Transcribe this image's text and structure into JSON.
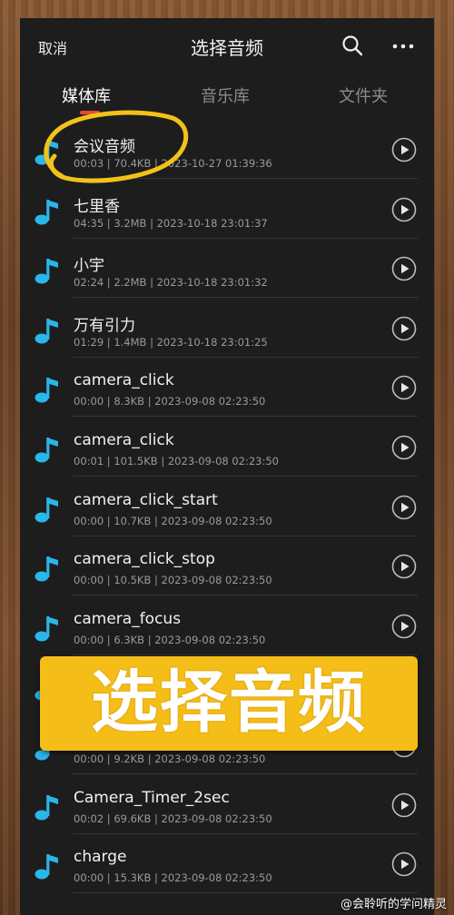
{
  "header": {
    "cancel_label": "取消",
    "title": "选择音频",
    "icons": [
      "search-icon",
      "more-icon"
    ]
  },
  "tabs": [
    {
      "label": "媒体库",
      "active": true
    },
    {
      "label": "音乐库",
      "active": false
    },
    {
      "label": "文件夹",
      "active": false
    }
  ],
  "files": [
    {
      "name": "会议音频",
      "meta": "00:03 | 70.4KB | 2023-10-27 01:39:36"
    },
    {
      "name": "七里香",
      "meta": "04:35 | 3.2MB | 2023-10-18 23:01:37"
    },
    {
      "name": "小宇",
      "meta": "02:24 | 2.2MB | 2023-10-18 23:01:32"
    },
    {
      "name": "万有引力",
      "meta": "01:29 | 1.4MB | 2023-10-18 23:01:25"
    },
    {
      "name": "camera_click",
      "meta": "00:00 | 8.3KB | 2023-09-08 02:23:50"
    },
    {
      "name": "camera_click",
      "meta": "00:01 | 101.5KB | 2023-09-08 02:23:50"
    },
    {
      "name": "camera_click_start",
      "meta": "00:00 | 10.7KB | 2023-09-08 02:23:50"
    },
    {
      "name": "camera_click_stop",
      "meta": "00:00 | 10.5KB | 2023-09-08 02:23:50"
    },
    {
      "name": "camera_focus",
      "meta": "00:00 | 6.3KB | 2023-09-08 02:23:50"
    },
    {
      "name": "",
      "meta": ""
    },
    {
      "name": "",
      "meta": "00:00 | 9.2KB | 2023-09-08 02:23:50"
    },
    {
      "name": "Camera_Timer_2sec",
      "meta": "00:02 | 69.6KB | 2023-09-08 02:23:50"
    },
    {
      "name": "charge",
      "meta": "00:00 | 15.3KB | 2023-09-08 02:23:50"
    }
  ],
  "overlay": {
    "banner_text": "选择音频",
    "watermark": "@会聆听的学问精灵"
  },
  "colors": {
    "accent": "#e8473f",
    "icon": "#29b6e8",
    "highlight": "#f2c21a",
    "banner": "#f5bd18"
  }
}
